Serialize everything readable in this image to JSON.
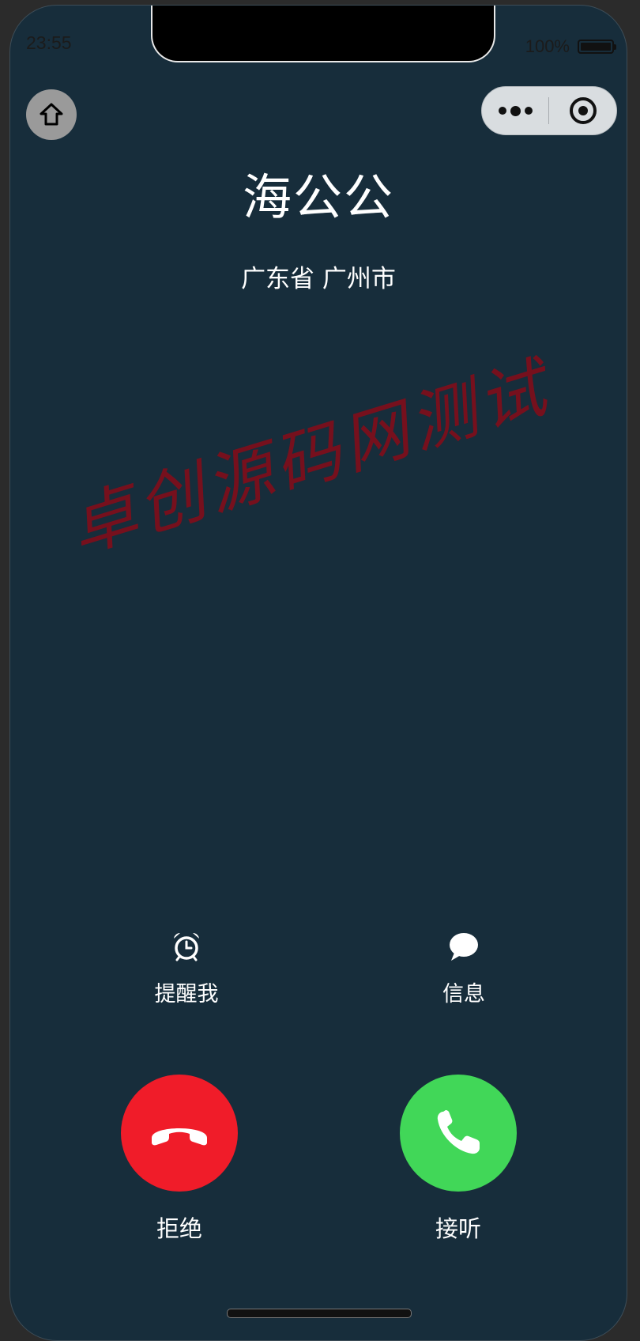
{
  "status_bar": {
    "time": "23:55",
    "battery_text": "100%"
  },
  "nav": {
    "home_icon": "home-icon",
    "more_icon": "more-dots-icon",
    "close_icon": "target-close-icon"
  },
  "caller": {
    "name": "海公公",
    "location": "广东省 广州市"
  },
  "watermark": "卓创源码网测试",
  "actions": [
    {
      "icon": "alarm-clock-icon",
      "label": "提醒我"
    },
    {
      "icon": "message-bubble-icon",
      "label": "信息"
    }
  ],
  "call_buttons": {
    "decline": {
      "label": "拒绝",
      "color": "#f01c29",
      "icon": "phone-hangup-icon"
    },
    "accept": {
      "label": "接听",
      "color": "#41d758",
      "icon": "phone-icon"
    }
  },
  "colors": {
    "background": "#172d3b",
    "watermark": "#7c0f1c"
  }
}
